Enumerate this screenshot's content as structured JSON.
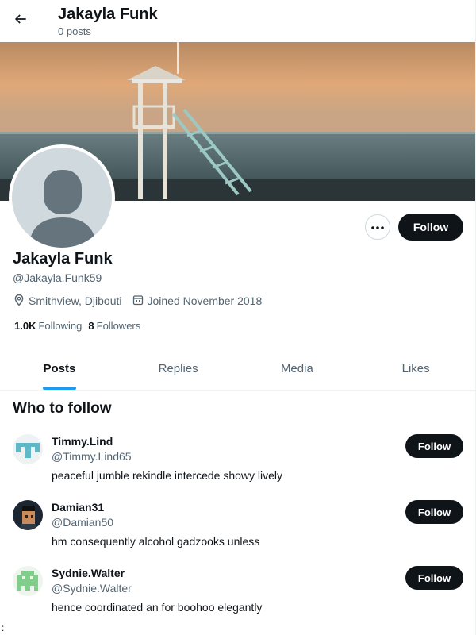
{
  "header": {
    "title": "Jakayla Funk",
    "subtitle": "0 posts",
    "back_icon": "arrow-left-icon"
  },
  "profile": {
    "name": "Jakayla Funk",
    "handle": "@Jakayla.Funk59",
    "location": "Smithview, Djibouti",
    "joined": "Joined November 2018",
    "following_count": "1.0K",
    "following_label": "Following",
    "followers_count": "8",
    "followers_label": "Followers",
    "follow_label": "Follow",
    "more_icon": "more-dots-icon"
  },
  "tabs": [
    {
      "label": "Posts",
      "active": true
    },
    {
      "label": "Replies",
      "active": false
    },
    {
      "label": "Media",
      "active": false
    },
    {
      "label": "Likes",
      "active": false
    }
  ],
  "who_to_follow": {
    "title": "Who to follow",
    "follow_label": "Follow",
    "items": [
      {
        "name": "Timmy.Lind",
        "handle": "@Timmy.Lind65",
        "bio": "peaceful jumble rekindle intercede showy lively"
      },
      {
        "name": "Damian31",
        "handle": "@Damian50",
        "bio": "hm consequently alcohol gadzooks unless"
      },
      {
        "name": "Sydnie.Walter",
        "handle": "@Sydnie.Walter",
        "bio": "hence coordinated an for boohoo elegantly"
      }
    ]
  },
  "stray_text": ":",
  "colors": {
    "accent": "#1d9bf0",
    "text": "#0f1419",
    "muted": "#536471",
    "button": "#0f1419"
  }
}
